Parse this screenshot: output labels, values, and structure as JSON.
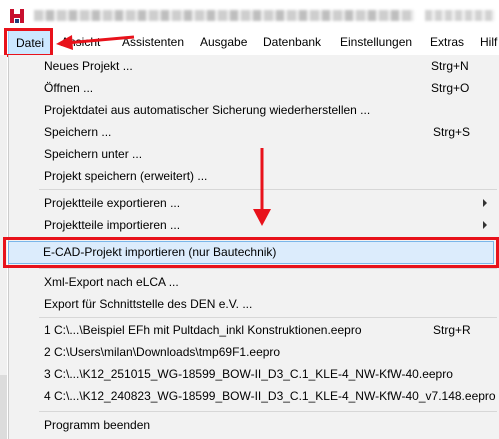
{
  "window": {
    "app_icon": "h-logo-icon",
    "title_blurred": true
  },
  "menubar": {
    "items": [
      "Datei",
      "Ansicht",
      "Assistenten",
      "Ausgabe",
      "Datenbank",
      "Einstellungen",
      "Extras",
      "Hilf"
    ]
  },
  "file_menu": {
    "items": [
      {
        "label": "Neues Projekt ...",
        "shortcut": "Strg+N"
      },
      {
        "label": "Öffnen ...",
        "shortcut": "Strg+O"
      },
      {
        "label": "Projektdatei aus automatischer Sicherung wiederherstellen ...",
        "shortcut": ""
      },
      {
        "label": "Speichern ...",
        "shortcut": "Strg+S"
      },
      {
        "label": "Speichern unter ...",
        "shortcut": ""
      },
      {
        "label": "Projekt speichern (erweitert) ...",
        "shortcut": ""
      },
      {
        "label": "Projektteile exportieren ...",
        "shortcut": "",
        "submenu": true
      },
      {
        "label": "Projektteile importieren ...",
        "shortcut": "",
        "submenu": true
      },
      {
        "label": "E-CAD-Projekt importieren (nur Bautechnik)",
        "shortcut": "",
        "highlighted": true
      },
      {
        "label": "Xml-Export nach eLCA ...",
        "shortcut": ""
      },
      {
        "label": "Export für Schnittstelle des DEN e.V. ...",
        "shortcut": ""
      },
      {
        "label": "1 C:\\...\\Beispiel EFh mit Pultdach_inkl Konstruktionen.eepro",
        "shortcut": "Strg+R"
      },
      {
        "label": "2 C:\\Users\\milan\\Downloads\\tmp69F1.eepro",
        "shortcut": ""
      },
      {
        "label": "3 C:\\...\\K12_251015_WG-18599_BOW-II_D3_C.1_KLE-4_NW-KfW-40.eepro",
        "shortcut": ""
      },
      {
        "label": "4 C:\\...\\K12_240823_WG-18599_BOW-II_D3_C.1_KLE-4_NW-KfW-40_v7.148.eepro",
        "shortcut": ""
      },
      {
        "label": "Programm beenden",
        "shortcut": ""
      }
    ]
  },
  "annotations": {
    "color": "#e8121b"
  }
}
